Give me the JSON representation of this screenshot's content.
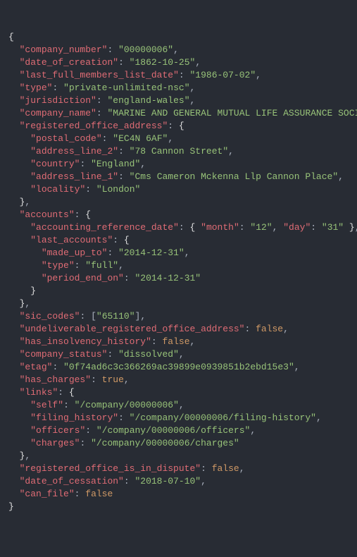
{
  "doc": {
    "company_number": "00000006",
    "date_of_creation": "1862-10-25",
    "last_full_members_list_date": "1986-07-02",
    "type_": "private-unlimited-nsc",
    "jurisdiction": "england-wales",
    "company_name": "MARINE AND GENERAL MUTUAL LIFE ASSURANCE SOCIETY",
    "registered_office_address": {
      "postal_code": "EC4N 6AF",
      "address_line_2": "78 Cannon Street",
      "country": "England",
      "address_line_1": "Cms Cameron Mckenna Llp Cannon Place",
      "locality": "London"
    },
    "accounts": {
      "accounting_reference_date": {
        "month": "12",
        "day": "31"
      },
      "last_accounts": {
        "made_up_to": "2014-12-31",
        "type_": "full",
        "period_end_on": "2014-12-31"
      }
    },
    "sic_codes": "65110",
    "undeliverable_registered_office_address": "false",
    "has_insolvency_history": "false",
    "company_status": "dissolved",
    "etag": "0f74ad6c3c366269ac39899e0939851b2ebd15e3",
    "has_charges": "true",
    "links": {
      "self_": "/company/00000006",
      "filing_history": "/company/00000006/filing-history",
      "officers": "/company/00000006/officers",
      "charges": "/company/00000006/charges"
    },
    "registered_office_is_in_dispute": "false",
    "date_of_cessation": "2018-07-10",
    "can_file": "false"
  },
  "keys": {
    "company_number": "company_number",
    "date_of_creation": "date_of_creation",
    "last_full_members_list_date": "last_full_members_list_date",
    "type_": "type",
    "jurisdiction": "jurisdiction",
    "company_name": "company_name",
    "registered_office_address": "registered_office_address",
    "postal_code": "postal_code",
    "address_line_2": "address_line_2",
    "country": "country",
    "address_line_1": "address_line_1",
    "locality": "locality",
    "accounts": "accounts",
    "accounting_reference_date": "accounting_reference_date",
    "month": "month",
    "day": "day",
    "last_accounts": "last_accounts",
    "made_up_to": "made_up_to",
    "period_end_on": "period_end_on",
    "sic_codes": "sic_codes",
    "undeliverable_registered_office_address": "undeliverable_registered_office_address",
    "has_insolvency_history": "has_insolvency_history",
    "company_status": "company_status",
    "etag": "etag",
    "has_charges": "has_charges",
    "links": "links",
    "self_": "self",
    "filing_history": "filing_history",
    "officers": "officers",
    "charges": "charges",
    "registered_office_is_in_dispute": "registered_office_is_in_dispute",
    "date_of_cessation": "date_of_cessation",
    "can_file": "can_file"
  }
}
